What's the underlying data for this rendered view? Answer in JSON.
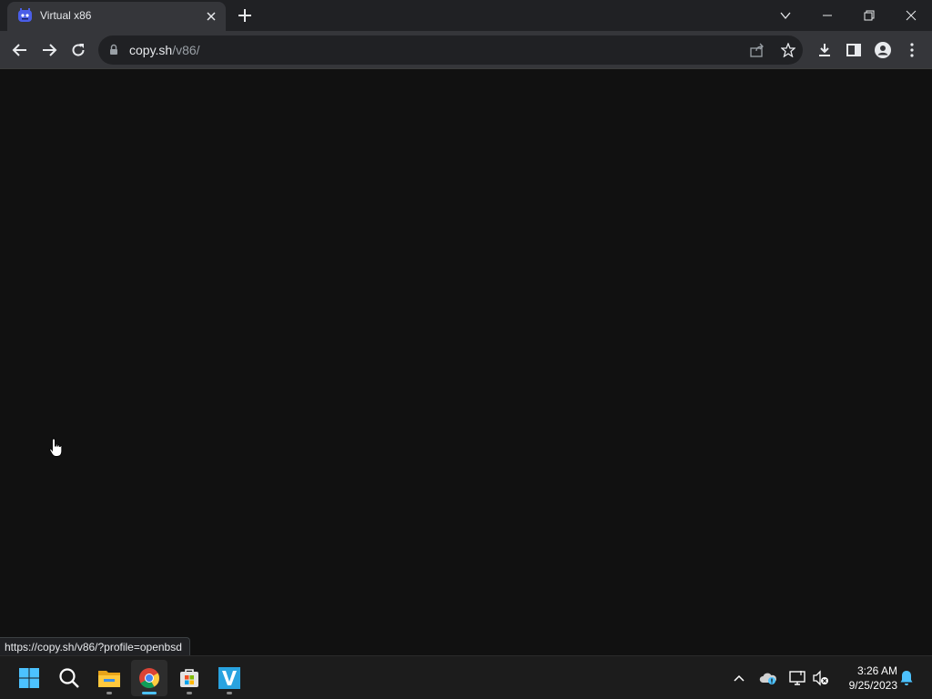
{
  "browser": {
    "tab": {
      "title": "Virtual x86",
      "favicon": "v86-logo-icon"
    },
    "address": {
      "host": "copy.sh",
      "path": "/v86/"
    },
    "status_url": "https://copy.sh/v86/?profile=openbsd"
  },
  "taskbar": {
    "apps": [
      "start-icon",
      "search-icon",
      "file-explorer-icon",
      "chrome-icon",
      "store-icon",
      "v-app-icon"
    ],
    "active_app": "chrome-icon",
    "clock": {
      "time": "3:26 AM",
      "date": "9/25/2023"
    }
  },
  "colors": {
    "accent": "#4cc2ff",
    "page_bg": "#111111",
    "toolbar": "#35363a"
  }
}
